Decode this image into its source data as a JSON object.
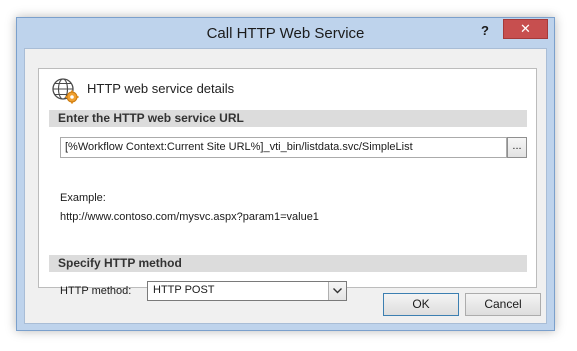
{
  "window": {
    "title": "Call HTTP Web Service",
    "help_label": "?",
    "close_label": "✕"
  },
  "details": {
    "heading": "HTTP web service details",
    "icon": "web-service-globe-gear-icon"
  },
  "url_section": {
    "header": "Enter the HTTP web service URL",
    "url_value": "[%Workflow Context:Current Site URL%]_vti_bin/listdata.svc/SimpleList",
    "browse_label": "...",
    "example_label": "Example:",
    "example_url": "http://www.contoso.com/mysvc.aspx?param1=value1"
  },
  "method_section": {
    "header": "Specify HTTP method",
    "label": "HTTP method:",
    "selected": "HTTP POST"
  },
  "buttons": {
    "ok": "OK",
    "cancel": "Cancel"
  },
  "colors": {
    "window_frame": "#bed3ec",
    "close_button": "#c74f4f",
    "section_header": "#dcdcdc"
  }
}
